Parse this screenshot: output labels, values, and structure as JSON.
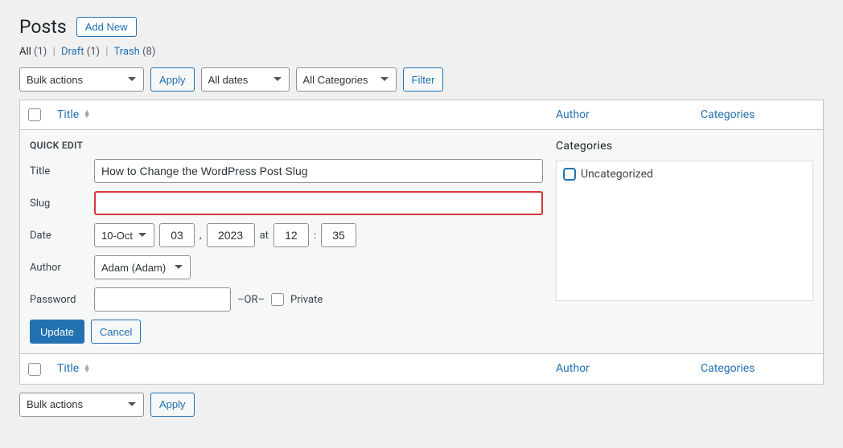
{
  "page": {
    "title": "Posts",
    "add_new": "Add New"
  },
  "views": {
    "all_label": "All",
    "all_count": "(1)",
    "draft_label": "Draft",
    "draft_count": "(1)",
    "trash_label": "Trash",
    "trash_count": "(8)"
  },
  "filters": {
    "bulk_actions": "Bulk actions",
    "apply": "Apply",
    "all_dates": "All dates",
    "all_categories": "All Categories",
    "filter": "Filter"
  },
  "columns": {
    "title": "Title",
    "author": "Author",
    "categories": "Categories"
  },
  "quickedit": {
    "heading": "QUICK EDIT",
    "labels": {
      "title": "Title",
      "slug": "Slug",
      "date": "Date",
      "author": "Author",
      "password": "Password",
      "or": "–OR–",
      "private": "Private",
      "at": "at",
      "comma": ",",
      "colon": ":",
      "categories_heading": "Categories"
    },
    "values": {
      "title": "How to Change the WordPress Post Slug",
      "slug": "",
      "month": "10-Oct",
      "day": "03",
      "year": "2023",
      "hour": "12",
      "minute": "35",
      "author": "Adam (Adam)",
      "password": ""
    },
    "categories": {
      "uncategorized": "Uncategorized"
    },
    "buttons": {
      "update": "Update",
      "cancel": "Cancel"
    }
  }
}
